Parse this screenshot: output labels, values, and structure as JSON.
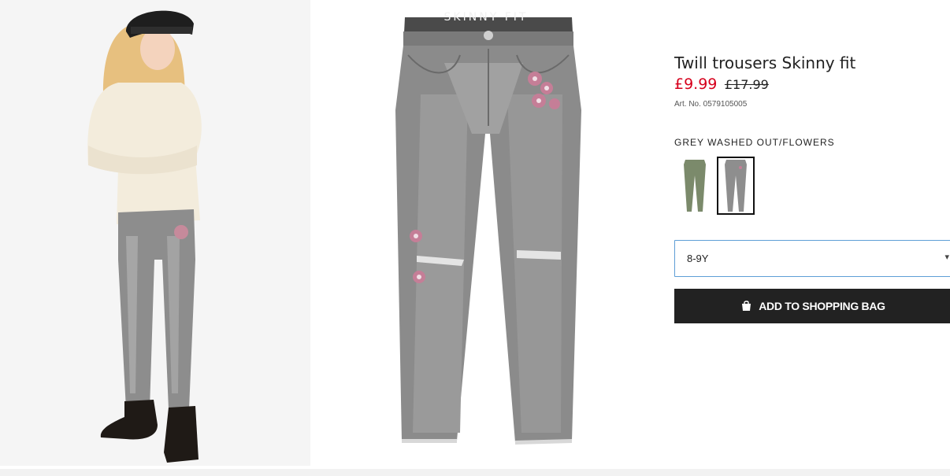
{
  "product": {
    "waist_text": "SKINNY FIT",
    "title": "Twill trousers Skinny fit",
    "price_sale": "£9.99",
    "price_old": "£17.99",
    "article_no": "Art. No. 0579105005",
    "color_name": "GREY WASHED OUT/FLOWERS"
  },
  "swatches": [
    {
      "name": "khaki-green",
      "color": "#7b8a6b",
      "selected": false
    },
    {
      "name": "grey-washed-out-flowers",
      "color": "#8e8e8e",
      "selected": true
    }
  ],
  "size_select": {
    "value": "8-9Y",
    "icon": "chevron-down-icon"
  },
  "add_button": {
    "label": "ADD TO SHOPPING BAG",
    "icon": "bag-icon"
  },
  "colors": {
    "sale": "#d6001c",
    "button": "#222222",
    "select_border": "#5e9ed6"
  }
}
